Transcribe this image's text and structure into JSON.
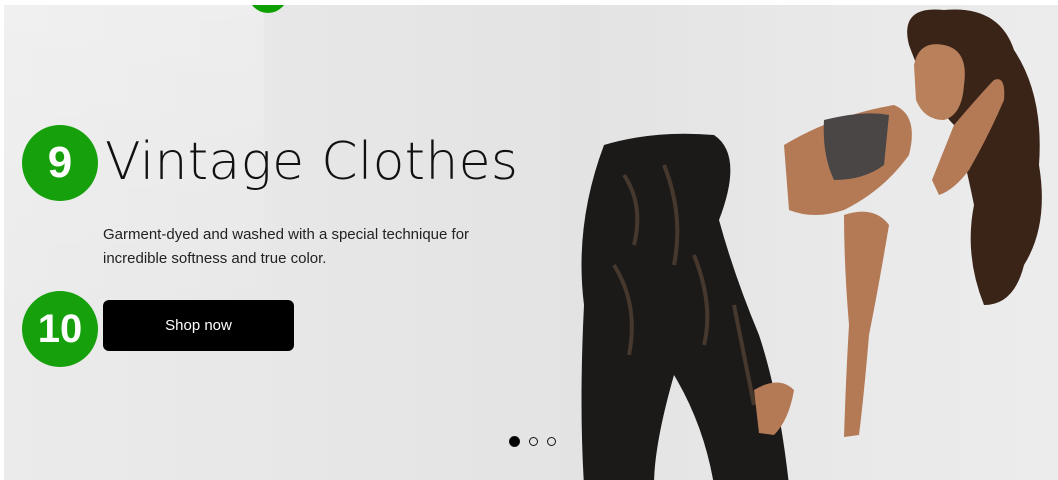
{
  "slide": {
    "title": "Vintage Clothes",
    "description": "Garment-dyed and washed with a special technique for incredible softness and true color.",
    "cta_label": "Shop now"
  },
  "annotations": {
    "title_marker": "9",
    "button_marker": "10"
  },
  "carousel": {
    "slide_count": 3,
    "active_index": 0
  },
  "colors": {
    "marker_green": "#16a10c",
    "button_bg": "#000000",
    "button_text": "#ffffff"
  }
}
